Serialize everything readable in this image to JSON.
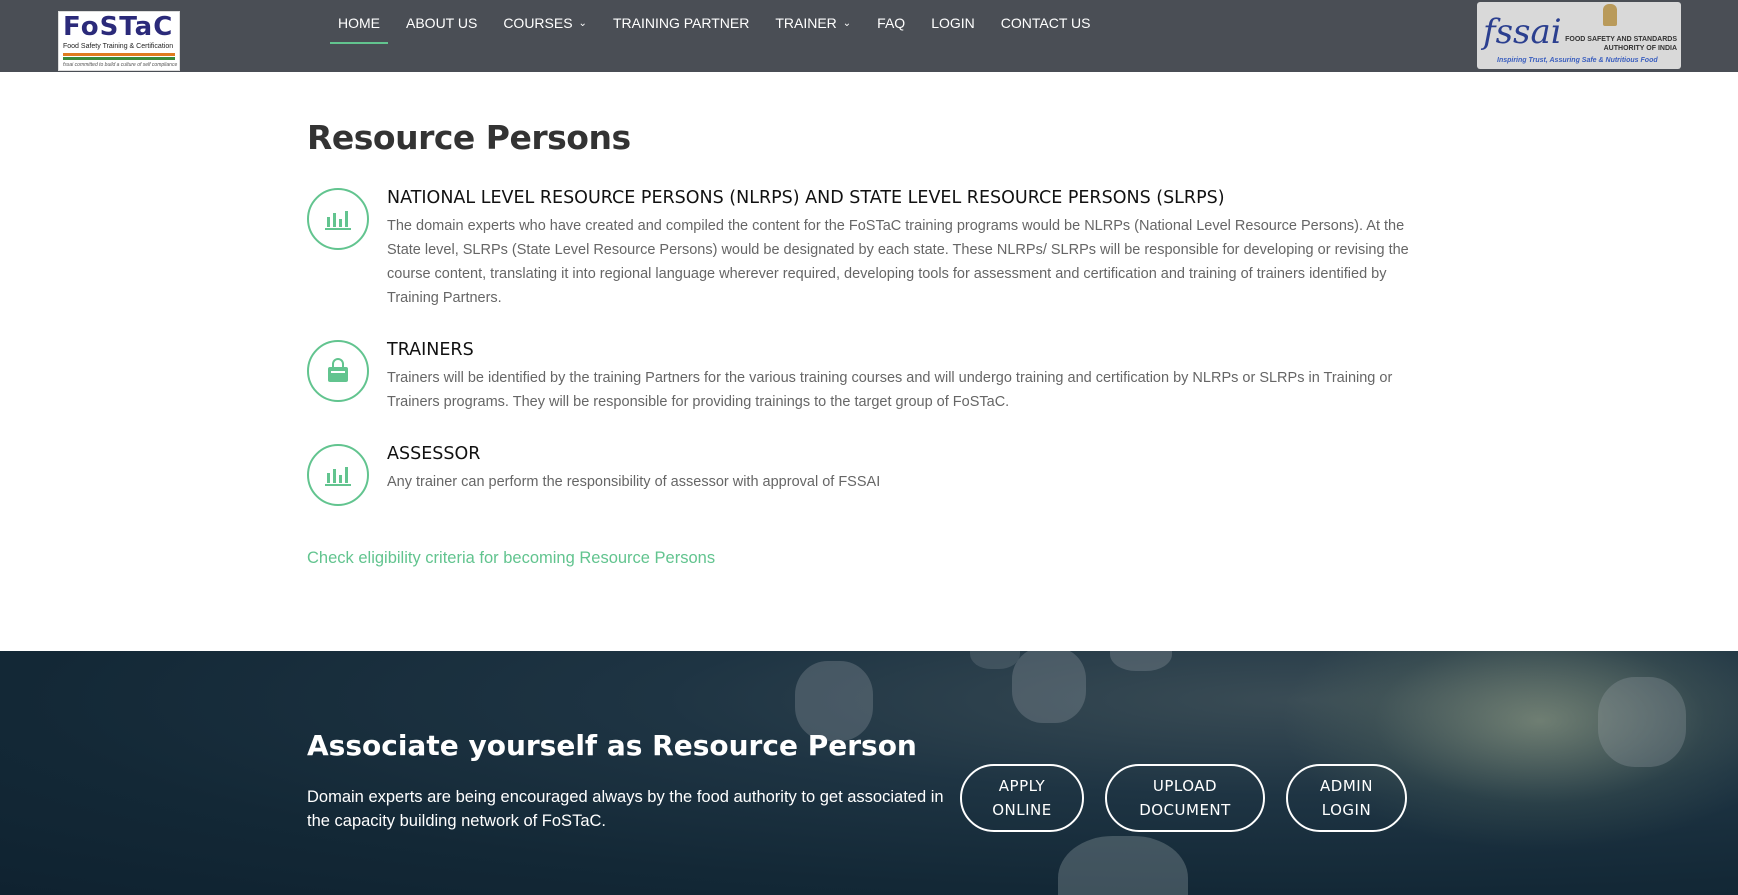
{
  "header": {
    "logo_left": {
      "name": "FoSTaC",
      "subtitle": "Food Safety Training & Certification",
      "tagline": "fssai committed to build a culture of self compliance"
    },
    "nav": [
      {
        "label": "HOME",
        "active": true
      },
      {
        "label": "ABOUT US"
      },
      {
        "label": "COURSES",
        "dropdown": true
      },
      {
        "label": "TRAINING PARTNER"
      },
      {
        "label": "TRAINER",
        "dropdown": true
      },
      {
        "label": "FAQ"
      },
      {
        "label": "LOGIN"
      },
      {
        "label": "CONTACT US"
      }
    ],
    "logo_right": {
      "name": "fssai",
      "authority": "FOOD SAFETY AND STANDARDS AUTHORITY OF INDIA",
      "tagline": "Inspiring Trust, Assuring Safe & Nutritious Food"
    }
  },
  "main": {
    "title": "Resource Persons",
    "features": [
      {
        "icon": "bar-chart-icon",
        "title": "NATIONAL LEVEL RESOURCE PERSONS (NLRPS) AND STATE LEVEL RESOURCE PERSONS (SLRPS)",
        "text": "The domain experts who have created and compiled the content for the FoSTaC training programs would be NLRPs (National Level Resource Persons). At the State level, SLRPs (State Level Resource Persons) would be designated by each state. These NLRPs/ SLRPs will be responsible for developing or revising the course content, translating it into regional language wherever required, developing tools for assessment and certification and training of trainers identified by Training Partners."
      },
      {
        "icon": "shopping-bag-icon",
        "title": "TRAINERS",
        "text": "Trainers will be identified by the training Partners for the various training courses and will undergo training and certification by NLRPs or SLRPs in Training or Trainers programs. They will be responsible for providing trainings to the target group of FoSTaC."
      },
      {
        "icon": "bar-chart-icon",
        "title": "ASSESSOR",
        "text": "Any trainer can perform the responsibility of assessor with approval of FSSAI"
      }
    ],
    "eligibility_link": "Check eligibility criteria for becoming Resource Persons"
  },
  "cta": {
    "title": "Associate yourself as Resource Person",
    "text": "Domain experts are being encouraged always by the food authority to get associated in the capacity building network of FoSTaC.",
    "buttons": [
      {
        "line1": "APPLY",
        "line2": "ONLINE"
      },
      {
        "line1": "UPLOAD",
        "line2": "DOCUMENT"
      },
      {
        "line1": "ADMIN",
        "line2": "LOGIN"
      }
    ]
  },
  "colors": {
    "header_bg": "#4a4e55",
    "accent": "#62c48f",
    "cta_bg": "#132836"
  }
}
